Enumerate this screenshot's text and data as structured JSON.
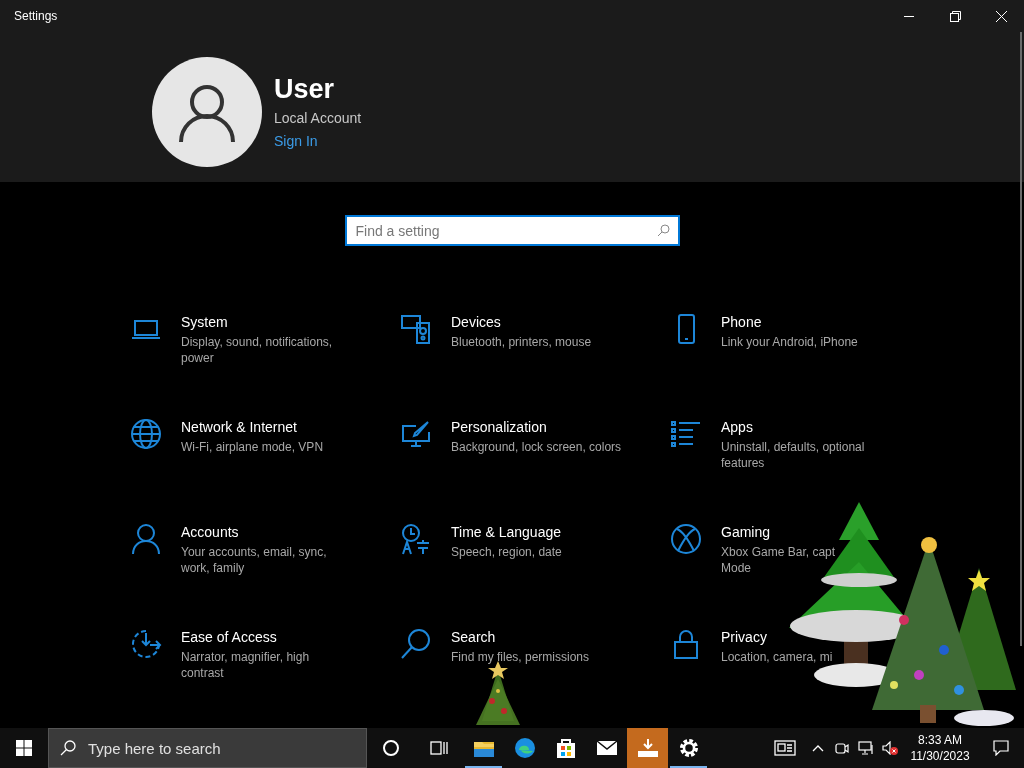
{
  "window": {
    "title": "Settings"
  },
  "user": {
    "name": "User",
    "account_type": "Local Account",
    "sign_in": "Sign In"
  },
  "search": {
    "placeholder": "Find a setting"
  },
  "categories": [
    {
      "title": "System",
      "description": [
        "Display, sound, notifications,",
        "power"
      ]
    },
    {
      "title": "Devices",
      "description": [
        "Bluetooth, printers, mouse"
      ]
    },
    {
      "title": "Phone",
      "description": [
        "Link your Android, iPhone"
      ]
    },
    {
      "title": "Network & Internet",
      "description": [
        "Wi-Fi, airplane mode, VPN"
      ]
    },
    {
      "title": "Personalization",
      "description": [
        "Background, lock screen, colors"
      ]
    },
    {
      "title": "Apps",
      "description": [
        "Uninstall, defaults, optional",
        "features"
      ]
    },
    {
      "title": "Accounts",
      "description": [
        "Your accounts, email, sync,",
        "work, family"
      ]
    },
    {
      "title": "Time & Language",
      "description": [
        "Speech, region, date"
      ]
    },
    {
      "title": "Gaming",
      "description": [
        "Xbox Game Bar, capt",
        "Mode"
      ]
    },
    {
      "title": "Ease of Access",
      "description": [
        "Narrator, magnifier, high",
        "contrast"
      ]
    },
    {
      "title": "Search",
      "description": [
        "Find my files, permissions"
      ]
    },
    {
      "title": "Privacy",
      "description": [
        "Location, camera, mi"
      ]
    }
  ],
  "taskbar": {
    "search_placeholder": "Type here to search",
    "apps": [
      {
        "running": true,
        "selected": false
      },
      {
        "running": false,
        "selected": false
      },
      {
        "running": false,
        "selected": false
      },
      {
        "running": false,
        "selected": false
      },
      {
        "running": false,
        "selected": true
      },
      {
        "running": true,
        "selected": false
      }
    ],
    "time": "8:33 AM",
    "date": "11/30/2023"
  }
}
